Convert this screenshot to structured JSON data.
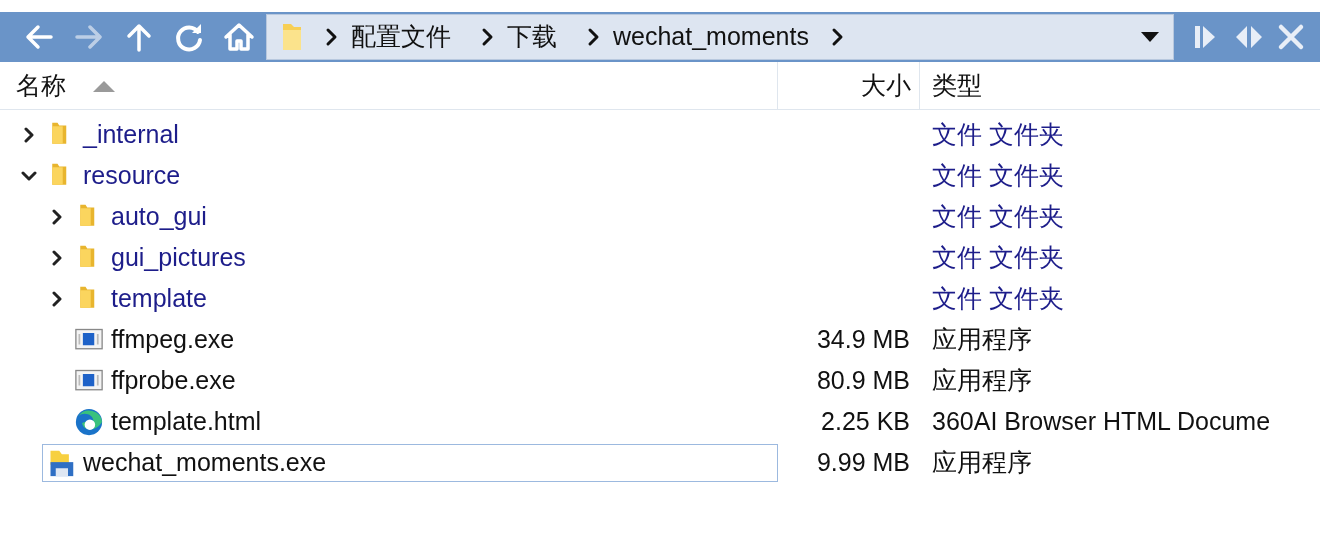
{
  "toolbar": {
    "buttons": [
      {
        "kind": "back",
        "disabled": false
      },
      {
        "kind": "forward",
        "disabled": true
      },
      {
        "kind": "up",
        "disabled": false
      },
      {
        "kind": "refresh",
        "disabled": false
      },
      {
        "kind": "home",
        "disabled": false
      }
    ]
  },
  "address_bar": {
    "crumbs": [
      "配置文件",
      "下载",
      "wechat_moments"
    ]
  },
  "columns": [
    {
      "label": "名称",
      "sorted": true
    },
    {
      "label": "大小",
      "sorted": false
    },
    {
      "label": "类型",
      "sorted": false
    }
  ],
  "files": [
    {
      "kind": "folder",
      "name": "_internal",
      "type": "文件 文件夹",
      "expanded": false,
      "selected": false
    },
    {
      "kind": "folder",
      "name": "resource",
      "type": "文件 文件夹",
      "expanded": true,
      "selected": false,
      "children": [
        {
          "kind": "folder",
          "name": "auto_gui",
          "type": "文件 文件夹",
          "expanded": false,
          "selected": false
        },
        {
          "kind": "folder",
          "name": "gui_pictures",
          "type": "文件 文件夹",
          "expanded": false,
          "selected": false
        },
        {
          "kind": "folder",
          "name": "template",
          "type": "文件 文件夹",
          "expanded": false,
          "selected": false
        },
        {
          "kind": "exe",
          "name": "ffmpeg.exe",
          "size": "34.9 MB",
          "type": "应用程序",
          "selected": false
        },
        {
          "kind": "exe",
          "name": "ffprobe.exe",
          "size": "80.9 MB",
          "type": "应用程序",
          "selected": false
        },
        {
          "kind": "html",
          "name": "template.html",
          "size": "2.25 KB",
          "type": "360AI Browser HTML Docume",
          "selected": false
        }
      ]
    },
    {
      "kind": "installer",
      "name": "wechat_moments.exe",
      "size": "9.99 MB",
      "type": "应用程序",
      "selected": true
    }
  ]
}
